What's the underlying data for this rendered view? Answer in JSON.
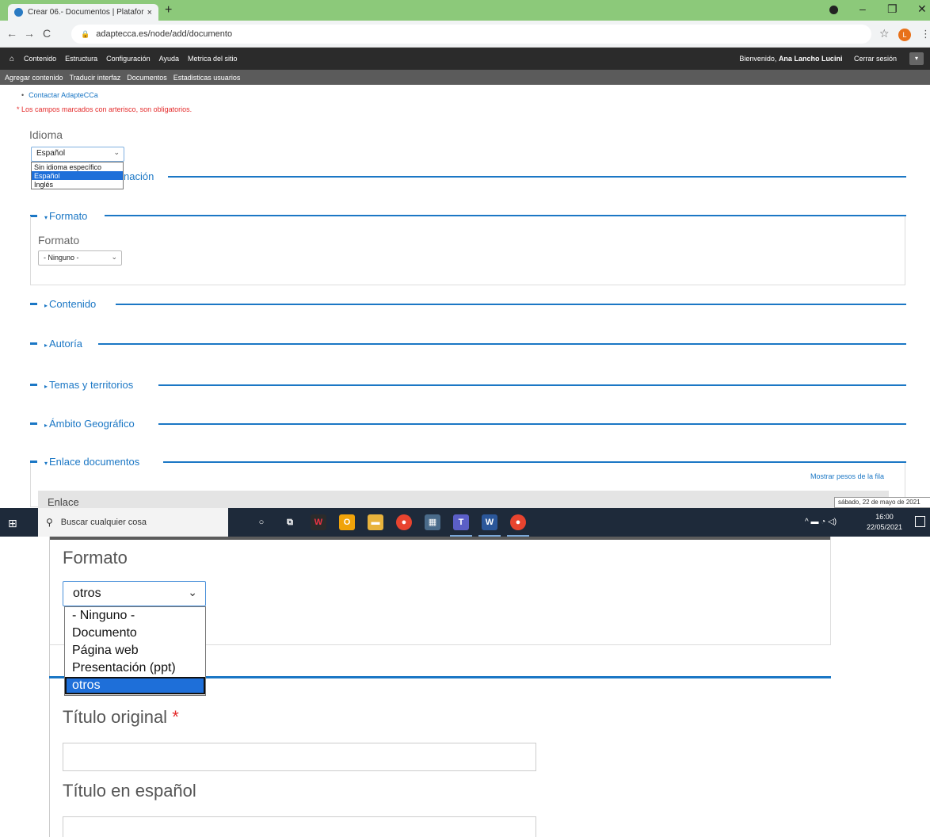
{
  "browser": {
    "tab_title": "Crear 06.- Documentos | Platafor",
    "tab_close": "×",
    "new_tab": "+",
    "url": "adaptecca.es/node/add/documento",
    "profile_initial": "L"
  },
  "admin_menu": {
    "items": [
      "Contenido",
      "Estructura",
      "Configuración",
      "Ayuda",
      "Metrica del sitio"
    ],
    "welcome": "Bienvenido,",
    "user": "Ana Lancho Lucini",
    "logout": "Cerrar sesión"
  },
  "shortcuts": [
    "Agregar contenido",
    "Traducir interfaz",
    "Documentos",
    "Estadisticas usuarios"
  ],
  "page": {
    "contact_link": "Contactar AdapteCCa",
    "required_note": "* Los campos marcados con arterisco, son obligatorios.",
    "idioma_label": "Idioma",
    "idioma_value": "Español",
    "idioma_options": [
      "Sin idioma específico",
      "Español",
      "Inglés"
    ],
    "idioma_selected_index": 1,
    "fieldsets": {
      "informacion": "nación",
      "formato": "Formato",
      "contenido": "Contenido",
      "autoria": "Autoría",
      "temas": "Temas y territorios",
      "ambito": "Ámbito Geográfico",
      "enlace": "Enlace documentos"
    },
    "formato_label": "Formato",
    "formato_value": "- Ninguno -",
    "show_weights": "Mostrar pesos de la fila",
    "enlace_label": "Enlace"
  },
  "taskbar": {
    "search_placeholder": "Buscar cualquier cosa",
    "time": "16:00",
    "date": "22/05/2021",
    "date_tooltip": "sábado, 22 de mayo de 2021"
  },
  "zoomed": {
    "formato_label": "Formato",
    "formato_value": "otros",
    "formato_options": [
      "- Ninguno -",
      "Documento",
      "Página web",
      "Presentación (ppt)",
      "otros"
    ],
    "formato_selected_index": 4,
    "titulo_original_label": "Título original",
    "required_star": "*",
    "titulo_espanol_label": "Título en español"
  }
}
